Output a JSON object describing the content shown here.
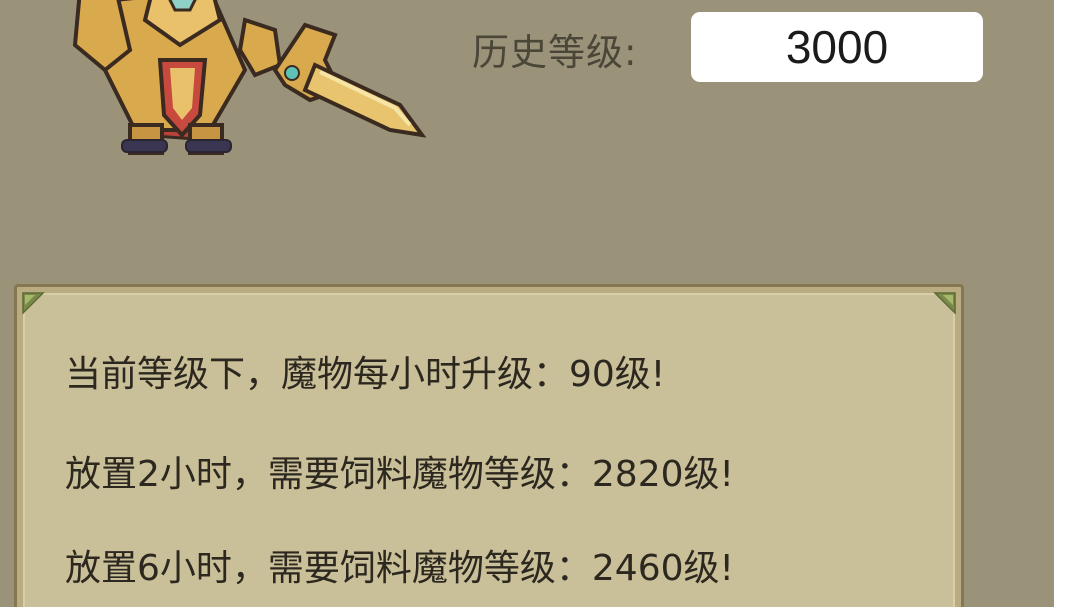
{
  "stats": {
    "history_level_label": "历史等级:",
    "history_level_value": "3000"
  },
  "info_panel": {
    "lines": [
      "当前等级下，魔物每小时升级：90级!",
      "放置2小时，需要饲料魔物等级：2820级!",
      "放置6小时，需要饲料魔物等级：2460级!"
    ]
  },
  "colors": {
    "background": "#9a9279",
    "panel": "#c9bf98",
    "panel_border": "#857752",
    "text": "#2c2820"
  },
  "icons": {
    "character": "golden-knight-sprite",
    "panel_corner": "leaf-ornament-icon"
  }
}
